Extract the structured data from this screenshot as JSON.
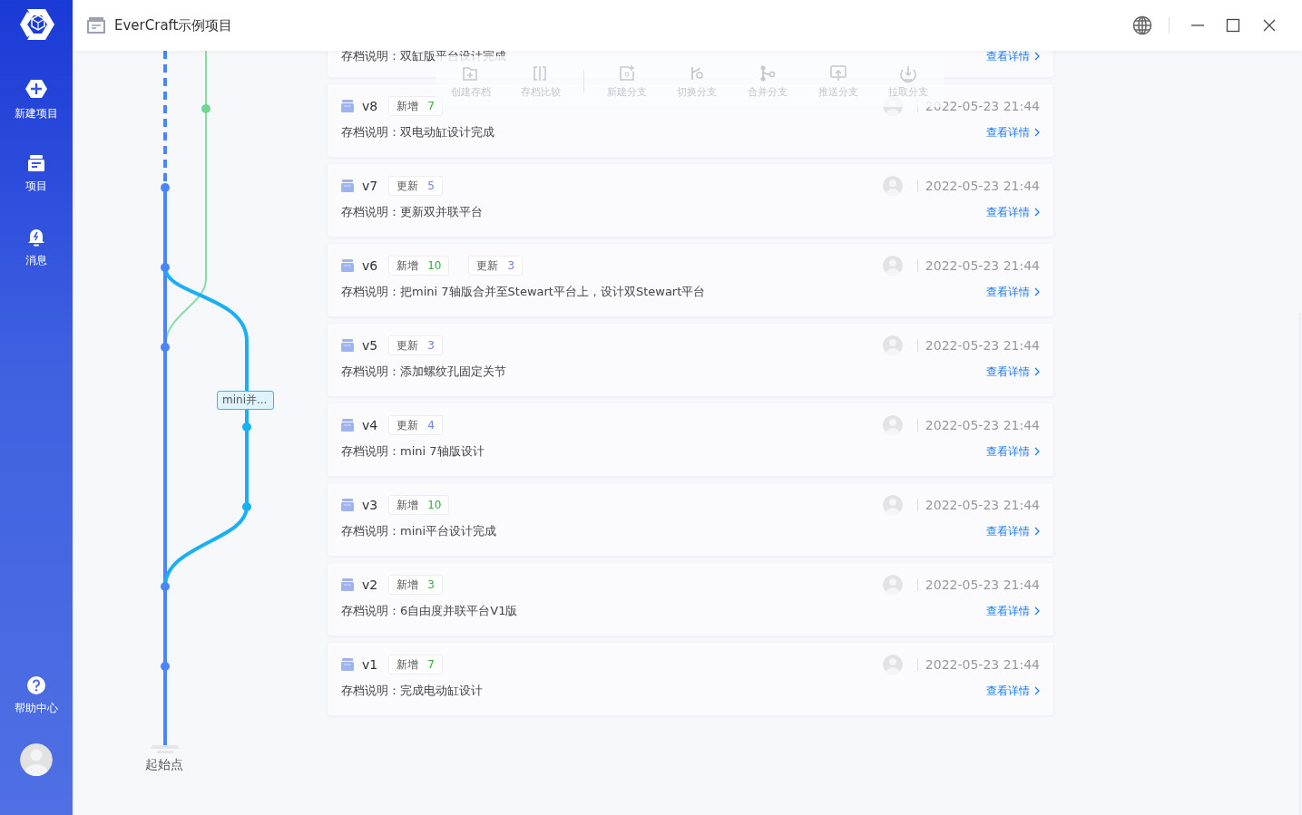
{
  "window": {
    "title": "EverCraft示例项目"
  },
  "sidebar": {
    "items": [
      {
        "label": "新建项目",
        "kind": "new"
      },
      {
        "label": "项目",
        "kind": "project"
      },
      {
        "label": "消息",
        "kind": "message"
      }
    ],
    "help": {
      "label": "帮助中心"
    }
  },
  "toolbar": [
    {
      "label": "创建存档",
      "kind": "create"
    },
    {
      "label": "存档比较",
      "kind": "compare"
    },
    {
      "label": "新建分支",
      "kind": "new-branch"
    },
    {
      "label": "切换分支",
      "kind": "switch"
    },
    {
      "label": "合并分支",
      "kind": "merge"
    },
    {
      "label": "推送分支",
      "kind": "push"
    },
    {
      "label": "拉取分支",
      "kind": "pull"
    }
  ],
  "graph": {
    "branch_label": "mini并...",
    "start_label": "起始点"
  },
  "cut_archive": {
    "description": "存档说明：双缸版平台设计完成",
    "link": "查看详情"
  },
  "archives": [
    {
      "version": "v8",
      "tags": [
        {
          "label": "新增",
          "count": "7",
          "kind": "add"
        }
      ],
      "time": "2022-05-23 21:44",
      "description": "存档说明：双电动缸设计完成",
      "link": "查看详情"
    },
    {
      "version": "v7",
      "tags": [
        {
          "label": "更新",
          "count": "5",
          "kind": "update"
        }
      ],
      "time": "2022-05-23 21:44",
      "description": "存档说明：更新双并联平台",
      "link": "查看详情"
    },
    {
      "version": "v6",
      "tags": [
        {
          "label": "新增",
          "count": "10",
          "kind": "add"
        },
        {
          "label": "更新",
          "count": "3",
          "kind": "update"
        }
      ],
      "time": "2022-05-23 21:44",
      "description": "存档说明：把mini 7轴版合并至Stewart平台上，设计双Stewart平台",
      "link": "查看详情"
    },
    {
      "version": "v5",
      "tags": [
        {
          "label": "更新",
          "count": "3",
          "kind": "update"
        }
      ],
      "time": "2022-05-23 21:44",
      "description": "存档说明：添加螺纹孔固定关节",
      "link": "查看详情"
    },
    {
      "version": "v4",
      "tags": [
        {
          "label": "更新",
          "count": "4",
          "kind": "update"
        }
      ],
      "time": "2022-05-23 21:44",
      "description": "存档说明：mini 7轴版设计",
      "link": "查看详情"
    },
    {
      "version": "v3",
      "tags": [
        {
          "label": "新增",
          "count": "10",
          "kind": "add"
        }
      ],
      "time": "2022-05-23 21:44",
      "description": "存档说明：mini平台设计完成",
      "link": "查看详情"
    },
    {
      "version": "v2",
      "tags": [
        {
          "label": "新增",
          "count": "3",
          "kind": "add"
        }
      ],
      "time": "2022-05-23 21:44",
      "description": "存档说明：6自由度并联平台V1版",
      "link": "查看详情"
    },
    {
      "version": "v1",
      "tags": [
        {
          "label": "新增",
          "count": "7",
          "kind": "add"
        }
      ],
      "time": "2022-05-23 21:44",
      "description": "存档说明：完成电动缸设计",
      "link": "查看详情"
    }
  ]
}
